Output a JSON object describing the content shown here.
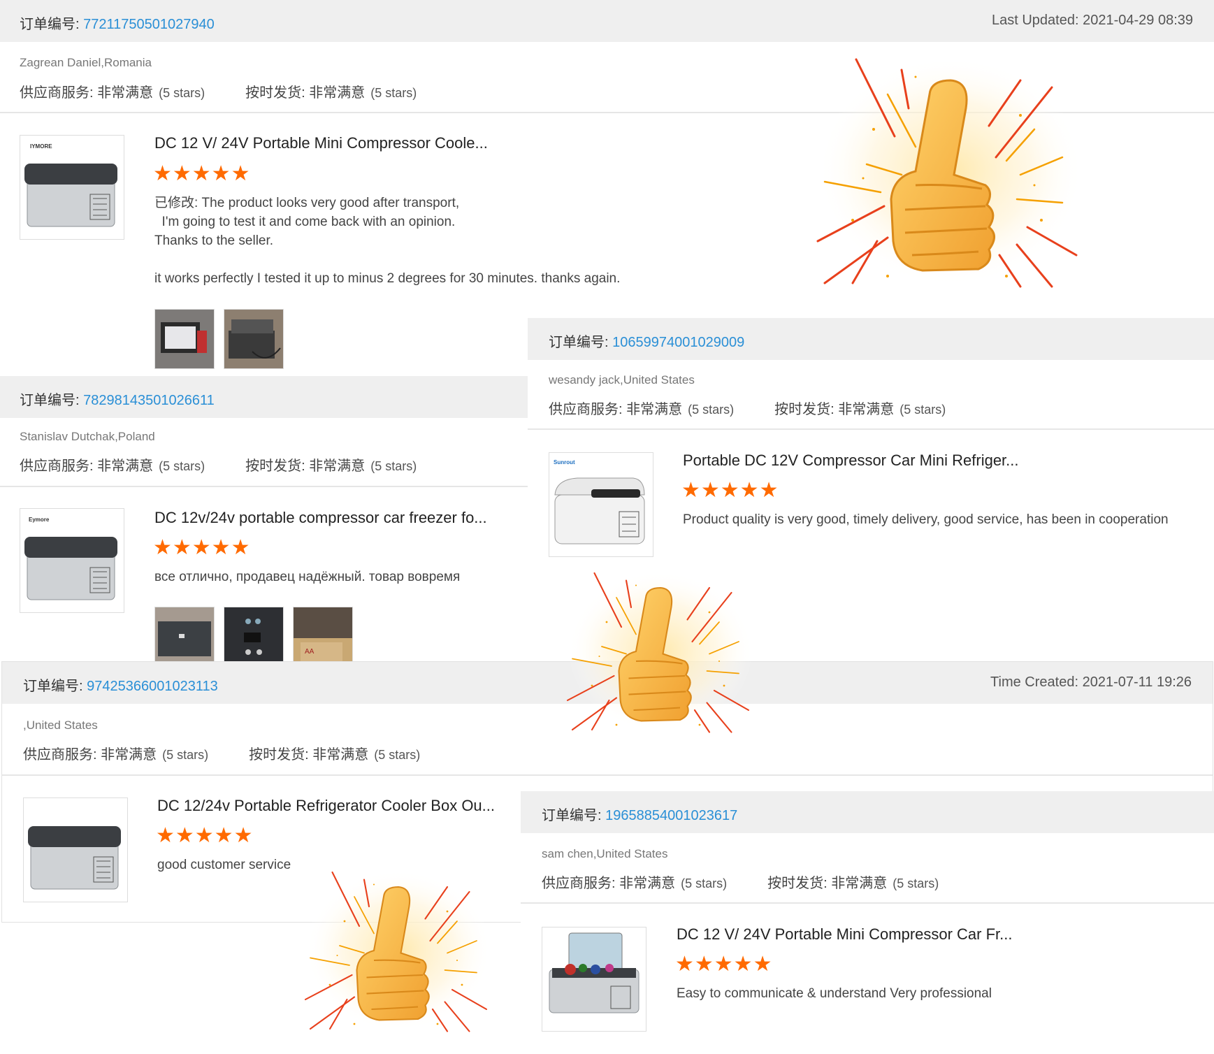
{
  "order_label": "订单编号: ",
  "supplier_label": "供应商服务: ",
  "delivery_label": "按时发货: ",
  "rating_word": "非常满意",
  "stars_text": "(5 stars)",
  "star_glyphs": "★★★★★",
  "colors": {
    "accent_link": "#2a8fd6",
    "star": "#ff6a00",
    "header_bg": "#efefef"
  },
  "reviews": [
    {
      "order_no": "77211750501027940",
      "meta": "Last Updated: 2021-04-29 08:39",
      "buyer": "Zagrean Daniel,Romania",
      "product_title": "DC 12 V/ 24V Portable Mini Compressor Coole...",
      "brand": "IYMORE",
      "review_lines": [
        "已修改: The product looks very good after transport,",
        "  I'm going to test it and come back with an opinion.",
        "Thanks to the seller.",
        "",
        "it works perfectly I tested it up to minus 2 degrees for 30 minutes. thanks again."
      ]
    },
    {
      "order_no": "78298143501026611",
      "buyer": "Stanislav Dutchak,Poland",
      "product_title": "DC 12v/24v portable compressor car freezer fo...",
      "brand": "Eymore",
      "review": "все отлично,  продавец надёжный. товар вовремя"
    },
    {
      "order_no": "10659974001029009",
      "buyer": "wesandy jack,United States",
      "product_title": "Portable DC 12V Compressor Car Mini Refriger...",
      "brand": "Sunrout",
      "review": "Product quality is very good, timely delivery, good service, has been in cooperation"
    },
    {
      "order_no": "97425366001023113",
      "meta": "Time Created: 2021-07-11 19:26",
      "buyer": ",United States",
      "product_title": "DC 12/24v Portable Refrigerator Cooler Box Ou...",
      "review": "good customer service"
    },
    {
      "order_no": "19658854001023617",
      "buyer": "sam chen,United States",
      "product_title": "DC 12 V/ 24V Portable Mini Compressor Car Fr...",
      "review": "Easy to communicate & understand Very professional"
    }
  ]
}
